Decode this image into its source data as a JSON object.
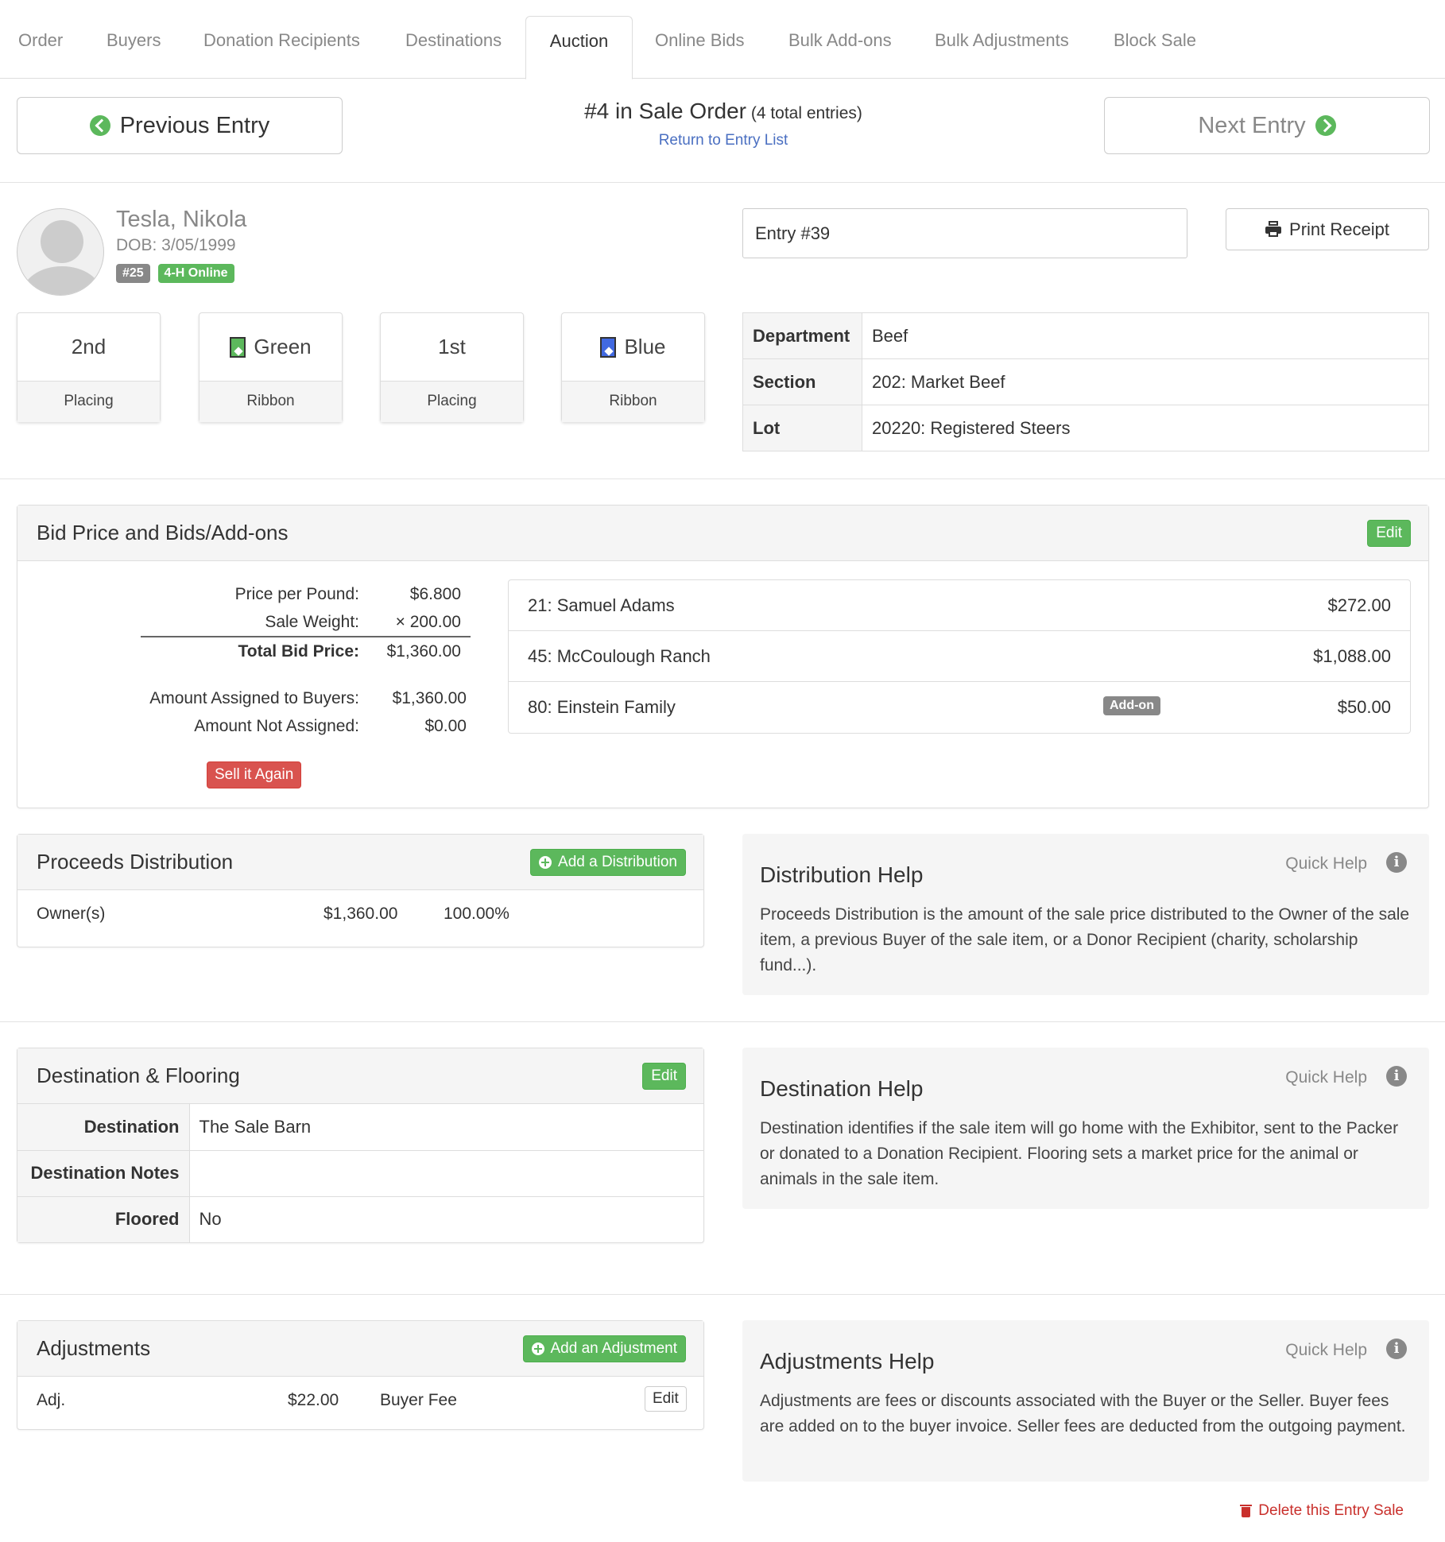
{
  "tabs": [
    "Order",
    "Buyers",
    "Donation Recipients",
    "Destinations",
    "Auction",
    "Online Bids",
    "Bulk Add-ons",
    "Bulk Adjustments",
    "Block Sale"
  ],
  "active_tab": "Auction",
  "nav": {
    "previous": "Previous Entry",
    "next": "Next Entry",
    "sale_order": "#4 in Sale Order",
    "total_entries": "(4 total entries)",
    "return_link": "Return to Entry List"
  },
  "exhibitor": {
    "name": "Tesla, Nikola",
    "dob": "DOB: 3/05/1999",
    "badge_number": "#25",
    "badge_online": "4-H Online"
  },
  "entry": {
    "entry_label": "Entry #39",
    "print_receipt": "Print Receipt"
  },
  "awards": [
    {
      "value": "2nd",
      "caption": "Placing",
      "ribbon": ""
    },
    {
      "value": "Green",
      "caption": "Ribbon",
      "ribbon": "#5cb85c"
    },
    {
      "value": "1st",
      "caption": "Placing",
      "ribbon": ""
    },
    {
      "value": "Blue",
      "caption": "Ribbon",
      "ribbon": "#4169e1"
    }
  ],
  "info": [
    {
      "key": "Department",
      "value": "Beef"
    },
    {
      "key": "Section",
      "value": "202: Market Beef"
    },
    {
      "key": "Lot",
      "value": "20220: Registered Steers"
    }
  ],
  "bid_panel": {
    "title": "Bid Price and Bids/Add-ons",
    "edit": "Edit",
    "price_per_pound_label": "Price per Pound:",
    "price_per_pound": "$6.800",
    "sale_weight_label": "Sale Weight:",
    "sale_weight": "× 200.00",
    "total_label": "Total Bid Price:",
    "total": "$1,360.00",
    "assigned_label": "Amount Assigned to Buyers:",
    "assigned": "$1,360.00",
    "not_assigned_label": "Amount Not Assigned:",
    "not_assigned": "$0.00",
    "sell_again": "Sell it Again",
    "buyers": [
      {
        "name": "21: Samuel Adams",
        "tag": "",
        "amount": "$272.00"
      },
      {
        "name": "45: McCoulough Ranch",
        "tag": "",
        "amount": "$1,088.00"
      },
      {
        "name": "80: Einstein Family",
        "tag": "Add-on",
        "amount": "$50.00"
      }
    ]
  },
  "proceeds": {
    "title": "Proceeds Distribution",
    "add": "Add a Distribution",
    "row": {
      "who": "Owner(s)",
      "amount": "$1,360.00",
      "pct": "100.00%"
    }
  },
  "distribution_help": {
    "quick": "Quick Help",
    "title": "Distribution Help",
    "text": "Proceeds Distribution is the amount of the sale price distributed to the Owner of the sale item, a previous Buyer of the sale item, or a Donor Recipient (charity, scholarship fund...)."
  },
  "destination": {
    "title": "Destination & Flooring",
    "edit": "Edit",
    "rows": [
      {
        "key": "Destination",
        "value": "The Sale Barn"
      },
      {
        "key": "Destination Notes",
        "value": ""
      },
      {
        "key": "Floored",
        "value": "No"
      }
    ]
  },
  "destination_help": {
    "quick": "Quick Help",
    "title": "Destination Help",
    "text": "Destination identifies if the sale item will go home with the Exhibitor, sent to the Packer or donated to a Donation Recipient. Flooring sets a market price for the animal or animals in the sale item."
  },
  "adjustments": {
    "title": "Adjustments",
    "add": "Add an Adjustment",
    "row": {
      "type": "Adj.",
      "amount": "$22.00",
      "desc": "Buyer Fee",
      "edit": "Edit"
    }
  },
  "adjustments_help": {
    "quick": "Quick Help",
    "title": "Adjustments Help",
    "text": "Adjustments are fees or discounts associated with the Buyer or the Seller. Buyer fees are added on to the buyer invoice. Seller fees are deducted from the outgoing payment."
  },
  "delete": "Delete this Entry Sale",
  "colors": {
    "green": "#5cb85c",
    "red": "#d9534f",
    "link": "#4a6fc1",
    "gray_badge": "#888888"
  }
}
